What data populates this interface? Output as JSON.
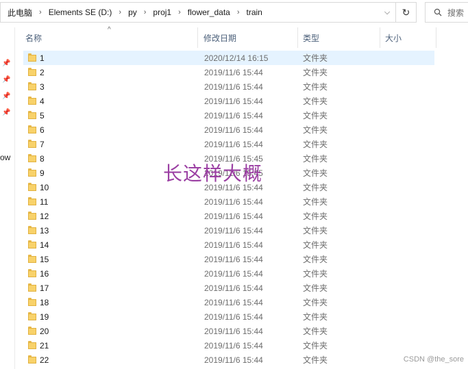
{
  "address_bar": {
    "crumbs": [
      "此电脑",
      "Elements SE (D:)",
      "py",
      "proj1",
      "flower_data",
      "train"
    ],
    "separator": "›",
    "dropdown_glyph": "⌵",
    "refresh_glyph": "↻"
  },
  "search": {
    "placeholder": "搜索",
    "icon": "search-icon"
  },
  "nav": {
    "partial_text": "ow",
    "pins": 4
  },
  "columns": {
    "name": "名称",
    "date": "修改日期",
    "type": "类型",
    "size": "大小",
    "sort_indicator": "^"
  },
  "rows": [
    {
      "name": "1",
      "date": "2020/12/14 16:15",
      "type": "文件夹",
      "selected": true
    },
    {
      "name": "2",
      "date": "2019/11/6 15:44",
      "type": "文件夹"
    },
    {
      "name": "3",
      "date": "2019/11/6 15:44",
      "type": "文件夹"
    },
    {
      "name": "4",
      "date": "2019/11/6 15:44",
      "type": "文件夹"
    },
    {
      "name": "5",
      "date": "2019/11/6 15:44",
      "type": "文件夹"
    },
    {
      "name": "6",
      "date": "2019/11/6 15:44",
      "type": "文件夹"
    },
    {
      "name": "7",
      "date": "2019/11/6 15:44",
      "type": "文件夹"
    },
    {
      "name": "8",
      "date": "2019/11/6 15:45",
      "type": "文件夹"
    },
    {
      "name": "9",
      "date": "2019/11/6 15:45",
      "type": "文件夹"
    },
    {
      "name": "10",
      "date": "2019/11/6 15:44",
      "type": "文件夹"
    },
    {
      "name": "11",
      "date": "2019/11/6 15:44",
      "type": "文件夹"
    },
    {
      "name": "12",
      "date": "2019/11/6 15:44",
      "type": "文件夹"
    },
    {
      "name": "13",
      "date": "2019/11/6 15:44",
      "type": "文件夹"
    },
    {
      "name": "14",
      "date": "2019/11/6 15:44",
      "type": "文件夹"
    },
    {
      "name": "15",
      "date": "2019/11/6 15:44",
      "type": "文件夹"
    },
    {
      "name": "16",
      "date": "2019/11/6 15:44",
      "type": "文件夹"
    },
    {
      "name": "17",
      "date": "2019/11/6 15:44",
      "type": "文件夹"
    },
    {
      "name": "18",
      "date": "2019/11/6 15:44",
      "type": "文件夹"
    },
    {
      "name": "19",
      "date": "2019/11/6 15:44",
      "type": "文件夹"
    },
    {
      "name": "20",
      "date": "2019/11/6 15:44",
      "type": "文件夹"
    },
    {
      "name": "21",
      "date": "2019/11/6 15:44",
      "type": "文件夹"
    },
    {
      "name": "22",
      "date": "2019/11/6 15:44",
      "type": "文件夹"
    }
  ],
  "overlay_text": "长这样大概",
  "watermark": "CSDN @the_sore",
  "colors": {
    "selected_row": "#e5f3ff",
    "overlay": "#9b3fa3",
    "folder": "#f8d26a"
  }
}
